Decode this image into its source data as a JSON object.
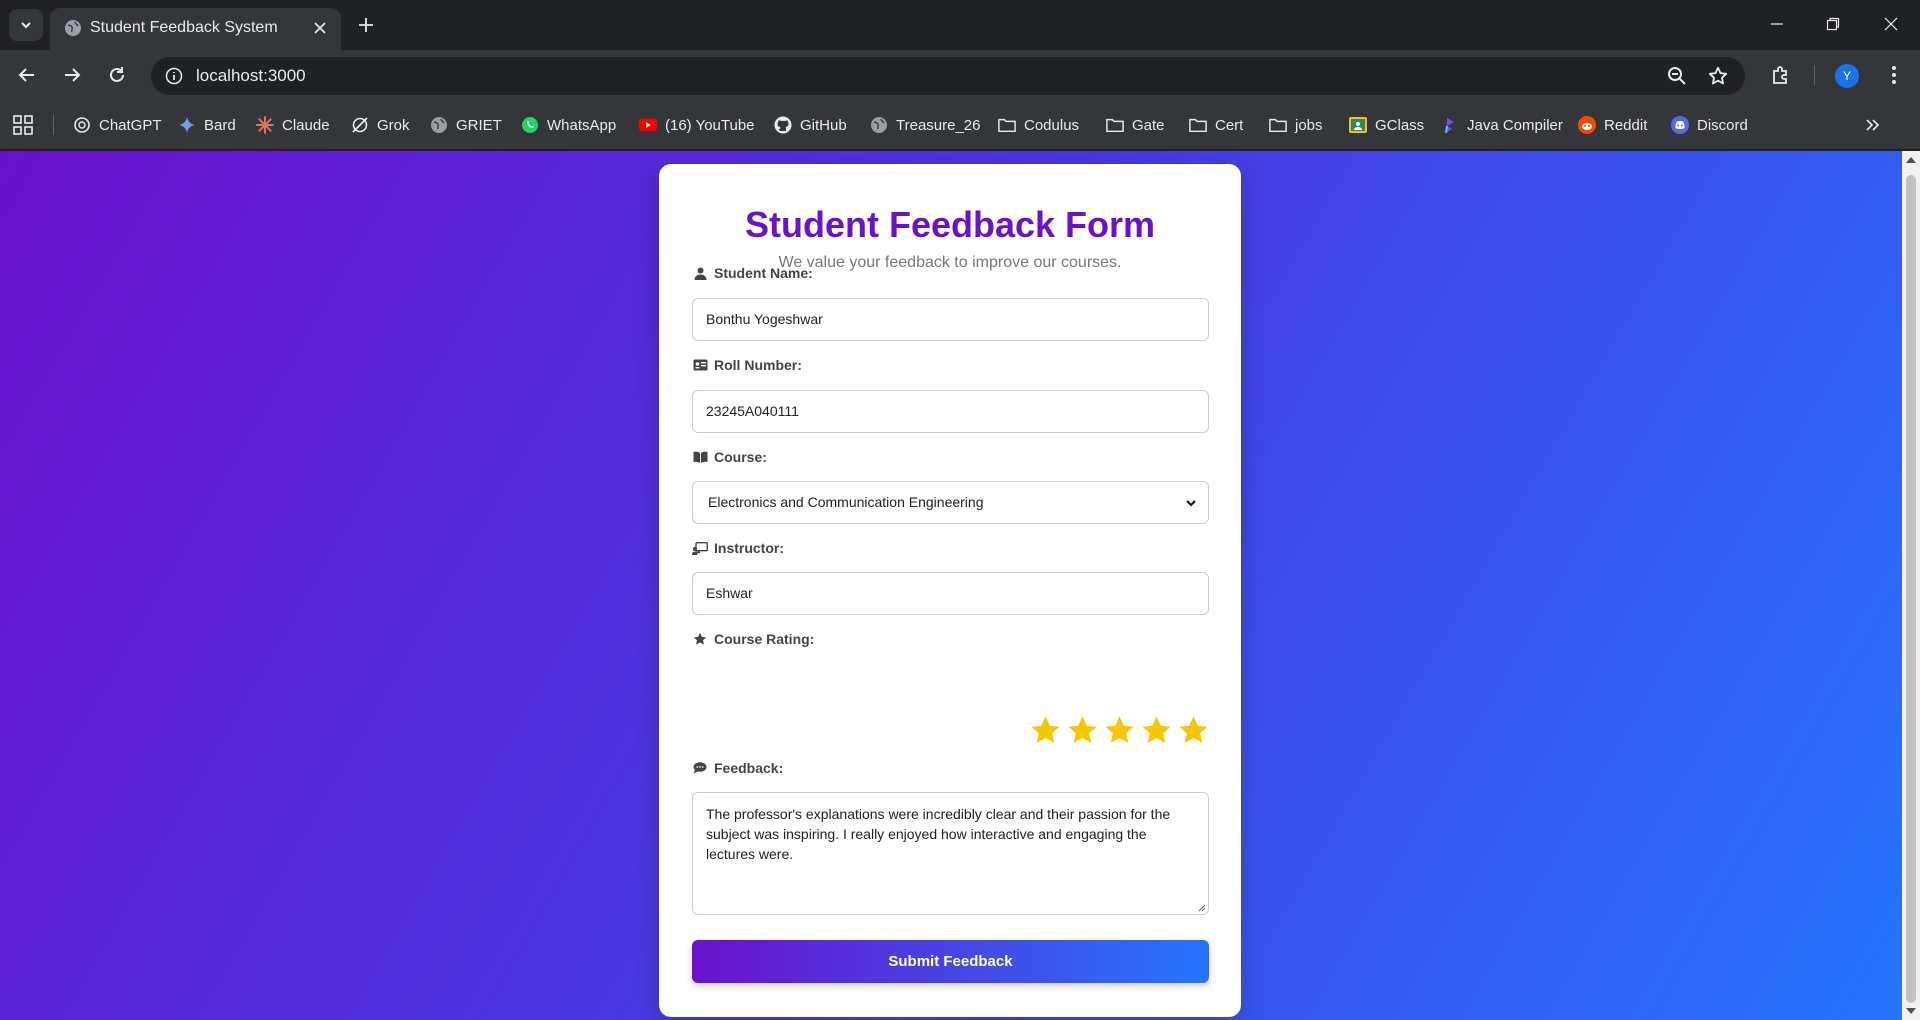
{
  "browser": {
    "tab": {
      "title": "Student Feedback System"
    },
    "address": {
      "url": "localhost:3000"
    },
    "avatar_letter": "Y",
    "bookmarks": [
      {
        "label": "ChatGPT",
        "icon": "chatgpt-icon"
      },
      {
        "label": "Bard",
        "icon": "bard-icon"
      },
      {
        "label": "Claude",
        "icon": "claude-icon"
      },
      {
        "label": "Grok",
        "icon": "grok-icon"
      },
      {
        "label": "GRIET",
        "icon": "globe-icon"
      },
      {
        "label": "WhatsApp",
        "icon": "whatsapp-icon"
      },
      {
        "label": "(16) YouTube",
        "icon": "youtube-icon"
      },
      {
        "label": "GitHub",
        "icon": "github-icon"
      },
      {
        "label": "Treasure_26",
        "icon": "globe-icon"
      },
      {
        "label": "Codulus",
        "icon": "folder-icon"
      },
      {
        "label": "Gate",
        "icon": "folder-icon"
      },
      {
        "label": "Cert",
        "icon": "folder-icon"
      },
      {
        "label": "jobs",
        "icon": "folder-icon"
      },
      {
        "label": "GClass",
        "icon": "gclass-icon"
      },
      {
        "label": "Java Compiler",
        "icon": "java-compiler-icon"
      },
      {
        "label": "Reddit",
        "icon": "reddit-icon"
      },
      {
        "label": "Discord",
        "icon": "discord-icon"
      }
    ]
  },
  "form": {
    "title": "Student Feedback Form",
    "subtitle": "We value your feedback to improve our courses.",
    "student_name": {
      "label": "Student Name:",
      "value": "Bonthu Yogeshwar"
    },
    "roll_number": {
      "label": "Roll Number:",
      "value": "23245A040111"
    },
    "course": {
      "label": "Course:",
      "selected": "Electronics and Communication Engineering"
    },
    "instructor": {
      "label": "Instructor:",
      "value": "Eshwar"
    },
    "rating": {
      "label": "Course Rating:",
      "value": 5,
      "max": 5
    },
    "feedback": {
      "label": "Feedback:",
      "value": "The professor's explanations were incredibly clear and their passion for the subject was inspiring. I really enjoyed how interactive and engaging the lectures were."
    },
    "submit_label": "Submit Feedback"
  },
  "colors": {
    "accent": "#6a11cb",
    "gradient_end": "#2575fc",
    "star": "#f7c600"
  }
}
